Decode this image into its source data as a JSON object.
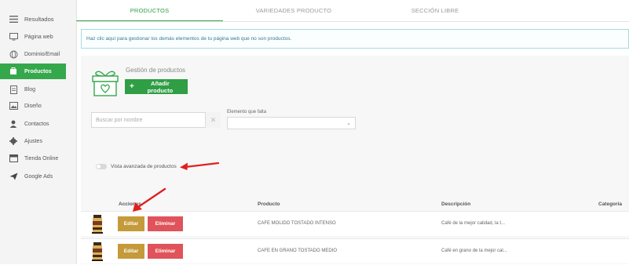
{
  "sidebar": {
    "items": [
      {
        "label": "Resultados",
        "icon": "menu-icon"
      },
      {
        "label": "Página web",
        "icon": "monitor-icon"
      },
      {
        "label": "Dominio/Email",
        "icon": "globe-icon"
      },
      {
        "label": "Productos",
        "icon": "product-icon",
        "active": true
      },
      {
        "label": "Blog",
        "icon": "document-icon"
      },
      {
        "label": "Diseño",
        "icon": "image-icon"
      },
      {
        "label": "Contactos",
        "icon": "person-icon"
      },
      {
        "label": "Ajustes",
        "icon": "gear-icon"
      },
      {
        "label": "Tienda Online",
        "icon": "store-icon"
      },
      {
        "label": "Google Ads",
        "icon": "paper-plane-icon"
      }
    ]
  },
  "tabs": [
    {
      "label": "PRODUCTOS",
      "active": true
    },
    {
      "label": "VARIEDADES PRODUCTO",
      "active": false
    },
    {
      "label": "SECCIÓN LIBRE",
      "active": false
    }
  ],
  "info": {
    "text": "Haz clic aquí para gestionar los demás elementos de tu página web que no son productos."
  },
  "panel": {
    "title": "Gestión de productos",
    "add_button": "Añadir producto"
  },
  "filters": {
    "search_placeholder": "Buscar por nombre",
    "clear_symbol": "✕",
    "missing_label": "Elemento que falta",
    "missing_value": ""
  },
  "advanced": {
    "label": "Vista avanzada de productos",
    "enabled": false
  },
  "table": {
    "headers": {
      "actions": "Acciones",
      "product": "Producto",
      "description": "Descripción",
      "category": "Categoría"
    },
    "rows": [
      {
        "edit": "Editar",
        "delete": "Eliminar",
        "product": "CAFE MOLIDO TOSTADO INTENSO",
        "description": "Café de la mejor calidad, la t..."
      },
      {
        "edit": "Editar",
        "delete": "Eliminar",
        "product": "CAFE EN GRANO TOSTADO MEDIO",
        "description": "Café en grano de la mejor cal..."
      }
    ]
  },
  "colors": {
    "accent": "#35a84c",
    "edit": "#c49a3a",
    "delete": "#e0535a",
    "annotation_arrow": "#e02020"
  }
}
